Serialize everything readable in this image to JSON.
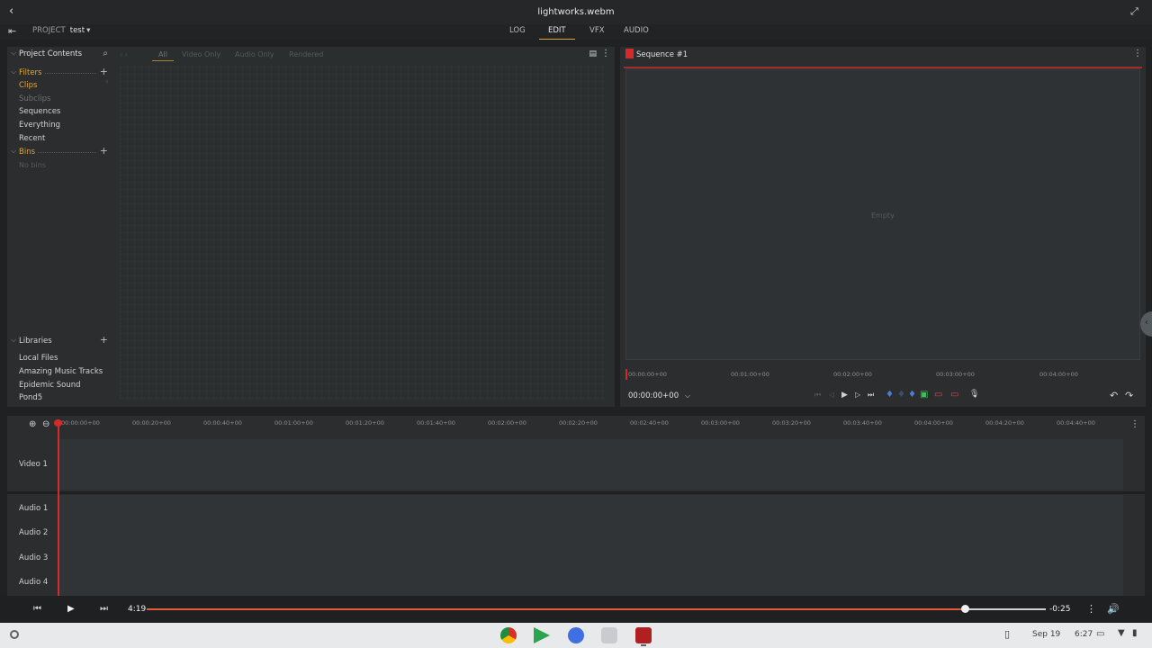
{
  "window": {
    "title": "lightworks.webm"
  },
  "project": {
    "label": "PROJECT",
    "name": "test"
  },
  "mode_tabs": [
    {
      "label": "LOG"
    },
    {
      "label": "EDIT"
    },
    {
      "label": "VFX"
    },
    {
      "label": "AUDIO"
    }
  ],
  "active_tab": "EDIT",
  "left_panel": {
    "header": "Project Contents",
    "filters_label": "Filters",
    "filters": [
      {
        "label": "Clips",
        "state": "selected"
      },
      {
        "label": "Subclips",
        "state": "dim"
      },
      {
        "label": "Sequences",
        "state": "normal"
      },
      {
        "label": "Everything",
        "state": "normal"
      },
      {
        "label": "Recent",
        "state": "normal"
      }
    ],
    "bins_label": "Bins",
    "bins_empty": "No bins",
    "libraries_label": "Libraries",
    "libraries": [
      "Local Files",
      "Amazing Music Tracks",
      "Epidemic Sound",
      "Pond5"
    ]
  },
  "bin_filter_tabs": [
    "All",
    "Video Only",
    "Audio Only",
    "Rendered"
  ],
  "viewer": {
    "title": "Sequence #1",
    "empty_text": "Empty",
    "timecode": "00:00:00+00",
    "ruler": [
      "00:00:00+00",
      "00:01:00+00",
      "00:02:00+00",
      "00:03:00+00",
      "00:04:00+00"
    ]
  },
  "timeline": {
    "ruler": [
      "00:00:00+00",
      "00:00:20+00",
      "00:00:40+00",
      "00:01:00+00",
      "00:01:20+00",
      "00:01:40+00",
      "00:02:00+00",
      "00:02:20+00",
      "00:02:40+00",
      "00:03:00+00",
      "00:03:20+00",
      "00:03:40+00",
      "00:04:00+00",
      "00:04:20+00",
      "00:04:40+00"
    ],
    "tracks": [
      "Video 1",
      "Audio 1",
      "Audio 2",
      "Audio 3",
      "Audio 4"
    ]
  },
  "player": {
    "elapsed": "4:19",
    "remaining": "-0:25",
    "progress": 0.91
  },
  "shelf": {
    "date": "Sep 19",
    "time": "6:27"
  },
  "colors": {
    "accent": "#e0a43a",
    "playhead": "#d42a2a",
    "progress": "#e55a3a"
  }
}
